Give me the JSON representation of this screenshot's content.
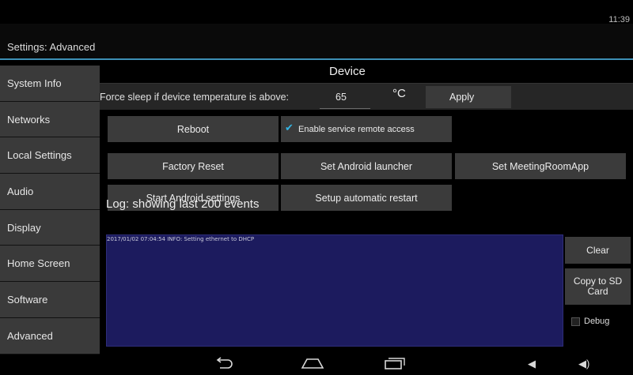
{
  "statusbar": {
    "clock": "11:39"
  },
  "header": {
    "title": "Settings: Advanced"
  },
  "sidebar": {
    "items": [
      {
        "label": "System Info"
      },
      {
        "label": "Networks"
      },
      {
        "label": "Local Settings"
      },
      {
        "label": "Audio"
      },
      {
        "label": "Display"
      },
      {
        "label": "Home Screen"
      },
      {
        "label": "Software"
      },
      {
        "label": "Advanced"
      }
    ]
  },
  "device": {
    "section_title": "Device",
    "temp_label": "Force sleep if device temperature is above:",
    "temp_value": "65",
    "temp_unit": "°C",
    "apply_label": "Apply",
    "reboot_label": "Reboot",
    "remote_access_label": "Enable service remote access",
    "remote_access_checked": true,
    "factory_reset_label": "Factory Reset",
    "android_launcher_label": "Set Android launcher",
    "meetingroom_label": "Set MeetingRoomApp",
    "android_settings_label": "Start Android settings",
    "auto_restart_label": "Setup automatic restart"
  },
  "log": {
    "title": "Log: showing last 200 events",
    "lines": [
      "2017/01/02 07:04:54 INFO: Setting ethernet to DHCP"
    ],
    "clear_label": "Clear",
    "copy_label": "Copy to SD Card",
    "debug_label": "Debug",
    "debug_checked": false
  },
  "colors": {
    "accent": "#33b5e5",
    "log_bg": "#1c1b5e",
    "header_line": "#3d8fb5"
  },
  "navbar": {
    "icons": [
      "back-icon",
      "home-icon",
      "recents-icon",
      "volume-down-icon",
      "volume-up-icon"
    ]
  }
}
